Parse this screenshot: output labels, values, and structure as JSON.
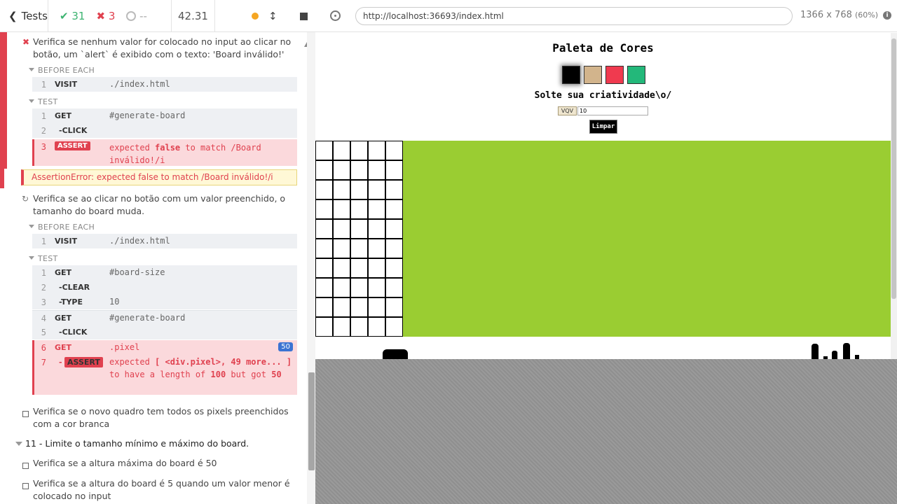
{
  "topbar": {
    "back_label": "Tests",
    "passed": "31",
    "failed": "3",
    "pending": "--",
    "duration": "42.31"
  },
  "reporter": {
    "test1": {
      "title": "Verifica se nenhum valor for colocado no input ao clicar no botão, um `alert` é exibido com o texto: 'Board inválido!'",
      "before_each_label": "BEFORE EACH",
      "before_each": [
        {
          "num": "1",
          "name": "VISIT",
          "arg": "./index.html"
        }
      ],
      "test_label": "TEST",
      "commands": [
        {
          "num": "1",
          "name": "GET",
          "arg": "#generate-board"
        },
        {
          "num": "2",
          "name": "-CLICK",
          "arg": ""
        },
        {
          "num": "3",
          "name": "ASSERT",
          "msg_a": "expected ",
          "msg_b": "false",
          "msg_c": " to match /Board inválido!/i"
        }
      ],
      "error": "AssertionError: expected false to match /Board inválido!/i"
    },
    "test2": {
      "title": "Verifica se ao clicar no botão com um valor preenchido, o tamanho do board muda.",
      "before_each_label": "BEFORE EACH",
      "before_each": [
        {
          "num": "1",
          "name": "VISIT",
          "arg": "./index.html"
        }
      ],
      "test_label": "TEST",
      "commands": [
        {
          "num": "1",
          "name": "GET",
          "arg": "#board-size"
        },
        {
          "num": "2",
          "name": "-CLEAR",
          "arg": ""
        },
        {
          "num": "3",
          "name": "-TYPE",
          "arg": "10"
        },
        {
          "num": "4",
          "name": "GET",
          "arg": "#generate-board"
        },
        {
          "num": "5",
          "name": "-CLICK",
          "arg": ""
        },
        {
          "num": "6",
          "name": "GET",
          "arg": ".pixel",
          "count": "50"
        },
        {
          "num": "7",
          "name": "ASSERT",
          "msg_1": "expected ",
          "msg_2": "[ <div.pixel>, 49 more... ]",
          "msg_3": " to have a length of ",
          "msg_4": "100",
          "msg_5": " but got ",
          "msg_6": "50"
        }
      ]
    },
    "test3": {
      "title": "Verifica se o novo quadro tem todos os pixels preenchidos com a cor branca"
    },
    "suite11": {
      "title": "11 - Limite o tamanho mínimo e máximo do board."
    },
    "test4": {
      "title": "Verifica se a altura máxima do board é 50"
    },
    "test5": {
      "title": "Verifica se a altura do board é 5 quando um valor menor é colocado no input"
    }
  },
  "aut": {
    "url": "http://localhost:36693/index.html",
    "viewport": "1366 x 768",
    "scale": "(60%)"
  },
  "app": {
    "title": "Paleta de Cores",
    "colors": [
      "#000000",
      "#d2b48c",
      "#f03a4f",
      "#23b87a"
    ],
    "slogan": "Solte sua criatividade\\o/",
    "vqv_label": "VQV",
    "size_value": "10",
    "clear_label": "Limpar",
    "board_bg": "#9acd32",
    "board_rows": 10,
    "board_cols": 5
  }
}
